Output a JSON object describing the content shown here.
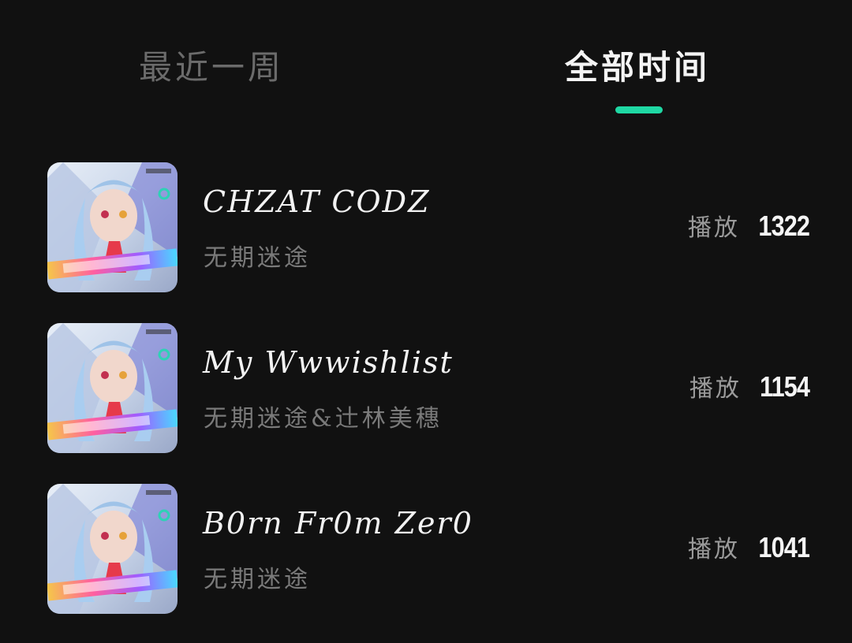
{
  "tabs": [
    {
      "label": "最近一周",
      "selected": false
    },
    {
      "label": "全部时间",
      "selected": true
    }
  ],
  "accent_color": "#1fd8a4",
  "plays_label": "播放",
  "songs": [
    {
      "title": "CHZAT CODZ",
      "artist": "无期迷途",
      "plays": "1322"
    },
    {
      "title": "My Wwwishlist",
      "artist": "无期迷途&辻林美穗",
      "plays": "1154"
    },
    {
      "title": "B0rn Fr0m Zer0",
      "artist": "无期迷途",
      "plays": "1041"
    }
  ],
  "cover_icon": "album-cover-art"
}
